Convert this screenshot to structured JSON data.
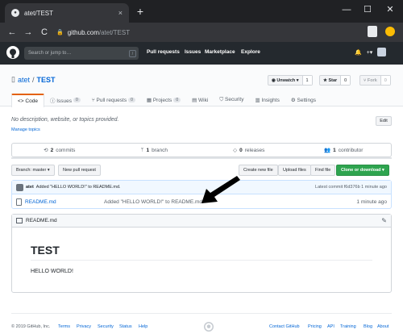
{
  "browser": {
    "tab_title": "atet/TEST",
    "tab_close": "×",
    "new_tab": "+",
    "minimize": "—",
    "maximize": "☐",
    "close": "✕",
    "back": "←",
    "forward": "→",
    "reload": "C",
    "url_host": "github.com",
    "url_path": "/atet/TEST"
  },
  "github_header": {
    "search_placeholder": "Search or jump to…",
    "search_key": "/",
    "nav": [
      "Pull requests",
      "Issues",
      "Marketplace",
      "Explore"
    ],
    "bell": "🔔",
    "plus": "+▾"
  },
  "repo": {
    "owner": "atet",
    "separator": "/",
    "name": "TEST",
    "unwatch_label": "◉ Unwatch ▾",
    "unwatch_count": "1",
    "star_label": "★ Star",
    "star_count": "0",
    "fork_label": "⑂ Fork",
    "fork_count": "0",
    "tabs": [
      {
        "label": "<> Code",
        "badge": ""
      },
      {
        "label": "ⓘ Issues",
        "badge": "0"
      },
      {
        "label": "⑂ Pull requests",
        "badge": "0"
      },
      {
        "label": "▦ Projects",
        "badge": "0"
      },
      {
        "label": "▤ Wiki",
        "badge": ""
      },
      {
        "label": "⛉ Security",
        "badge": ""
      },
      {
        "label": "▥ Insights",
        "badge": ""
      },
      {
        "label": "⚙ Settings",
        "badge": ""
      }
    ],
    "description": "No description, website, or topics provided.",
    "manage_topics": "Manage topics",
    "edit": "Edit"
  },
  "summary": {
    "commits_count": "2",
    "commits_label": "commits",
    "branch_count": "1",
    "branch_label": "branch",
    "releases_count": "0",
    "releases_label": "releases",
    "contrib_count": "1",
    "contrib_label": "contributor"
  },
  "file_nav": {
    "branch": "Branch: master ▾",
    "new_pr": "New pull request",
    "create_file": "Create new file",
    "upload": "Upload files",
    "find": "Find file",
    "clone": "Clone or download ▾"
  },
  "commit": {
    "author": "atet",
    "message": "Added \"HELLO WORLD!\" to README.md.",
    "latest": "Latest commit f6d376b 1 minute ago"
  },
  "files": [
    {
      "name": "README.md",
      "message": "Added \"HELLO WORLD!\" to README.md.",
      "age": "1 minute ago"
    }
  ],
  "readme": {
    "header": "README.md",
    "pencil": "✎",
    "title": "TEST",
    "body": "HELLO WORLD!"
  },
  "footer": {
    "copyright": "© 2019 GitHub, Inc.",
    "left_links": [
      "Terms",
      "Privacy",
      "Security",
      "Status",
      "Help"
    ],
    "right_links": [
      "Contact GitHub",
      "Pricing",
      "API",
      "Training",
      "Blog",
      "About"
    ]
  }
}
